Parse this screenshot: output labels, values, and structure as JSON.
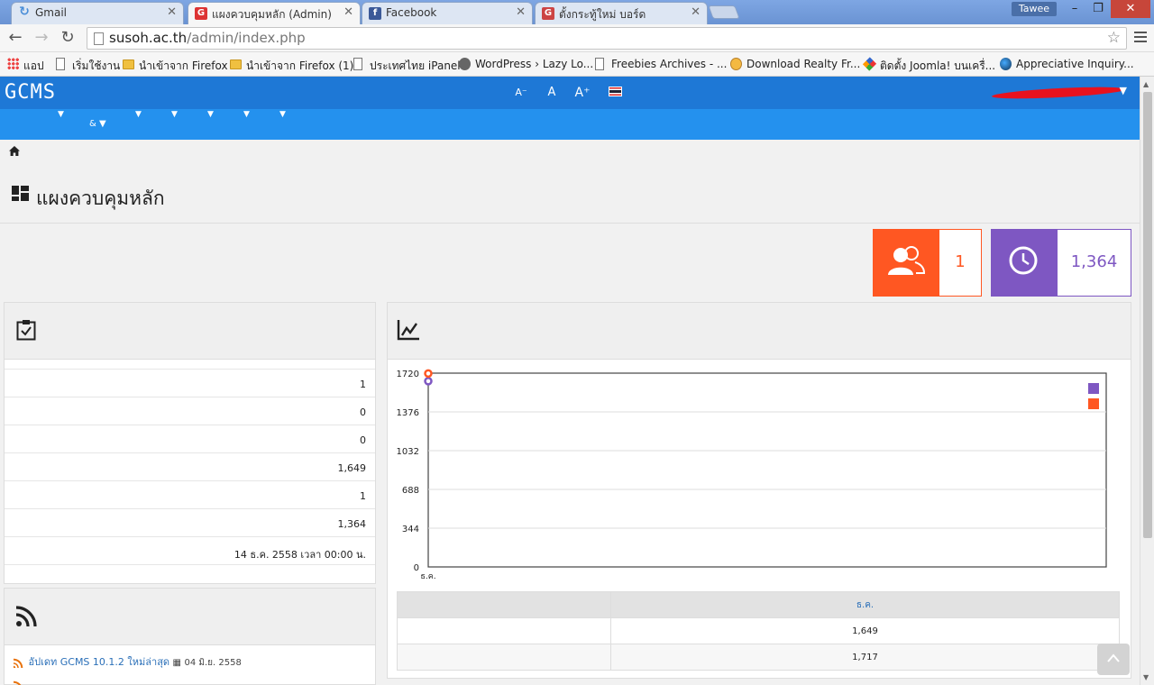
{
  "browser": {
    "tabs": [
      {
        "label": "Gmail",
        "favicon": "gmail-loading-icon",
        "active": false
      },
      {
        "label": "แผงควบคุมหลัก (Admin)",
        "favicon": "gcms-favicon",
        "active": true
      },
      {
        "label": "Facebook",
        "favicon": "facebook-icon",
        "active": false
      },
      {
        "label": "ตั้งกระทู้ใหม่ บอร์ด",
        "favicon": "gcms-favicon",
        "active": false
      }
    ],
    "window_user": "Tawee",
    "window_controls": {
      "minimize": "–",
      "maximize": "❐",
      "close": "✕"
    },
    "url_host": "susoh.ac.th",
    "url_path": "/admin/index.php",
    "bookmarks": [
      {
        "label": "แอป",
        "icon": "apps-grid-icon"
      },
      {
        "label": "เริ่มใช้งาน",
        "icon": "page-icon"
      },
      {
        "label": "นำเข้าจาก Firefox",
        "icon": "folder-icon"
      },
      {
        "label": "นำเข้าจาก Firefox (1)",
        "icon": "folder-icon"
      },
      {
        "label": "ประเทศไทย iPanel",
        "icon": "page-icon"
      },
      {
        "label": "WordPress › Lazy Lo...",
        "icon": "wordpress-icon"
      },
      {
        "label": "Freebies Archives - ...",
        "icon": "page-icon"
      },
      {
        "label": "Download Realty Fr...",
        "icon": "certificate-icon"
      },
      {
        "label": "ติดตั้ง Joomla! บนเครื่...",
        "icon": "joomla-icon"
      },
      {
        "label": "Appreciative Inquiry...",
        "icon": "globe-icon"
      }
    ]
  },
  "app": {
    "logo": "GCMS",
    "font_buttons": [
      "A⁻",
      "A",
      "A⁺"
    ],
    "menu_amp": "&",
    "breadcrumb_icon": "home-icon",
    "page_title": "แผงควบคุมหลัก",
    "stats": [
      {
        "icon": "users-icon",
        "value": "1",
        "color": "#ff5722"
      },
      {
        "icon": "clock-icon",
        "value": "1,364",
        "color": "#7e57c2"
      }
    ],
    "summary_rows": [
      "1",
      "0",
      "0",
      "1,649",
      "1",
      "1,364",
      "14 ธ.ค. 2558 เวลา 00:00 น."
    ],
    "feed": [
      {
        "title": "อัปเดท GCMS 10.1.2 ใหม่ล่าสุด",
        "date": "04 มิ.ย. 2558"
      }
    ],
    "table": {
      "header": [
        "",
        "ธ.ค."
      ],
      "rows": [
        [
          "",
          "1,649"
        ],
        [
          "",
          "1,717"
        ]
      ]
    },
    "scroll_top_icon": "chevron-up-icon"
  },
  "chart_data": {
    "type": "line",
    "categories": [
      "ธ.ค."
    ],
    "series": [
      {
        "values": [
          1649
        ],
        "color": "#7e57c2"
      },
      {
        "values": [
          1717
        ],
        "color": "#ff5722"
      }
    ],
    "ylim": [
      0,
      1720
    ],
    "yticks": [
      "0",
      "344",
      "688",
      "1032",
      "1376",
      "1720"
    ],
    "grid": true,
    "legend": "top-right"
  }
}
